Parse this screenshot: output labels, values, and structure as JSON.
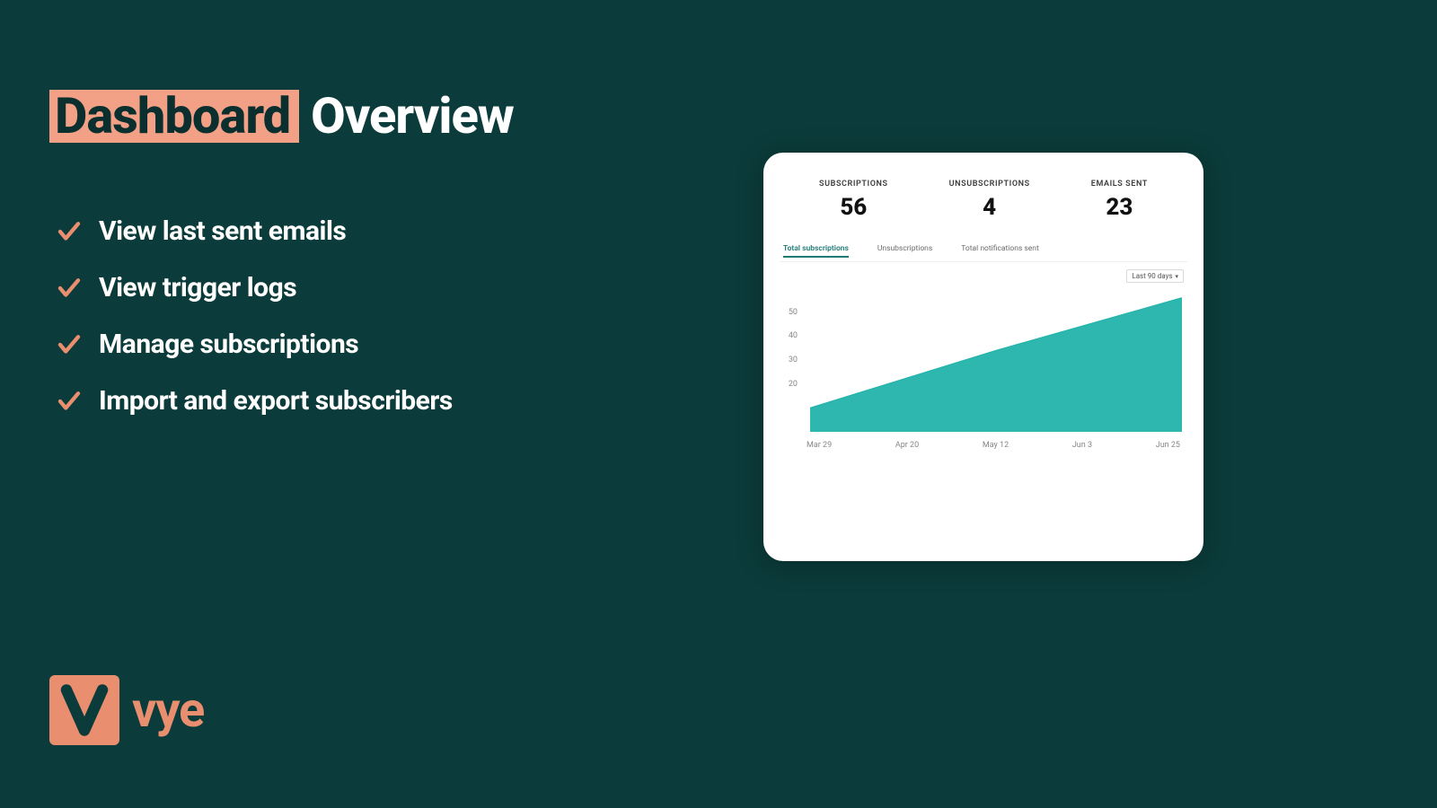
{
  "heading": {
    "highlight": "Dashboard",
    "rest": "Overview"
  },
  "bullets": [
    "View last sent emails",
    "View trigger logs",
    "Manage subscriptions",
    "Import and export subscribers"
  ],
  "logo": {
    "letter": "V",
    "text": "vye"
  },
  "dashboard": {
    "stats": [
      {
        "label": "SUBSCRIPTIONS",
        "value": "56"
      },
      {
        "label": "UNSUBSCRIPTIONS",
        "value": "4"
      },
      {
        "label": "EMAILS SENT",
        "value": "23"
      }
    ],
    "tabs": [
      {
        "label": "Total subscriptions",
        "active": true
      },
      {
        "label": "Unsubscriptions",
        "active": false
      },
      {
        "label": "Total notifications sent",
        "active": false
      }
    ],
    "range": "Last 90 days"
  },
  "chart_data": {
    "type": "area",
    "title": "Total subscriptions",
    "xlabel": "",
    "ylabel": "",
    "ylim": [
      0,
      60
    ],
    "y_ticks": [
      20,
      30,
      40,
      50
    ],
    "x_labels": [
      "Mar 29",
      "Apr 20",
      "May 12",
      "Jun 3",
      "Jun 25"
    ],
    "series": [
      {
        "name": "Total subscriptions",
        "color": "#22b3aa",
        "x": [
          "Mar 29",
          "Apr 20",
          "May 12",
          "Jun 3",
          "Jun 25"
        ],
        "values": [
          10,
          22,
          34,
          45,
          56
        ]
      }
    ]
  }
}
